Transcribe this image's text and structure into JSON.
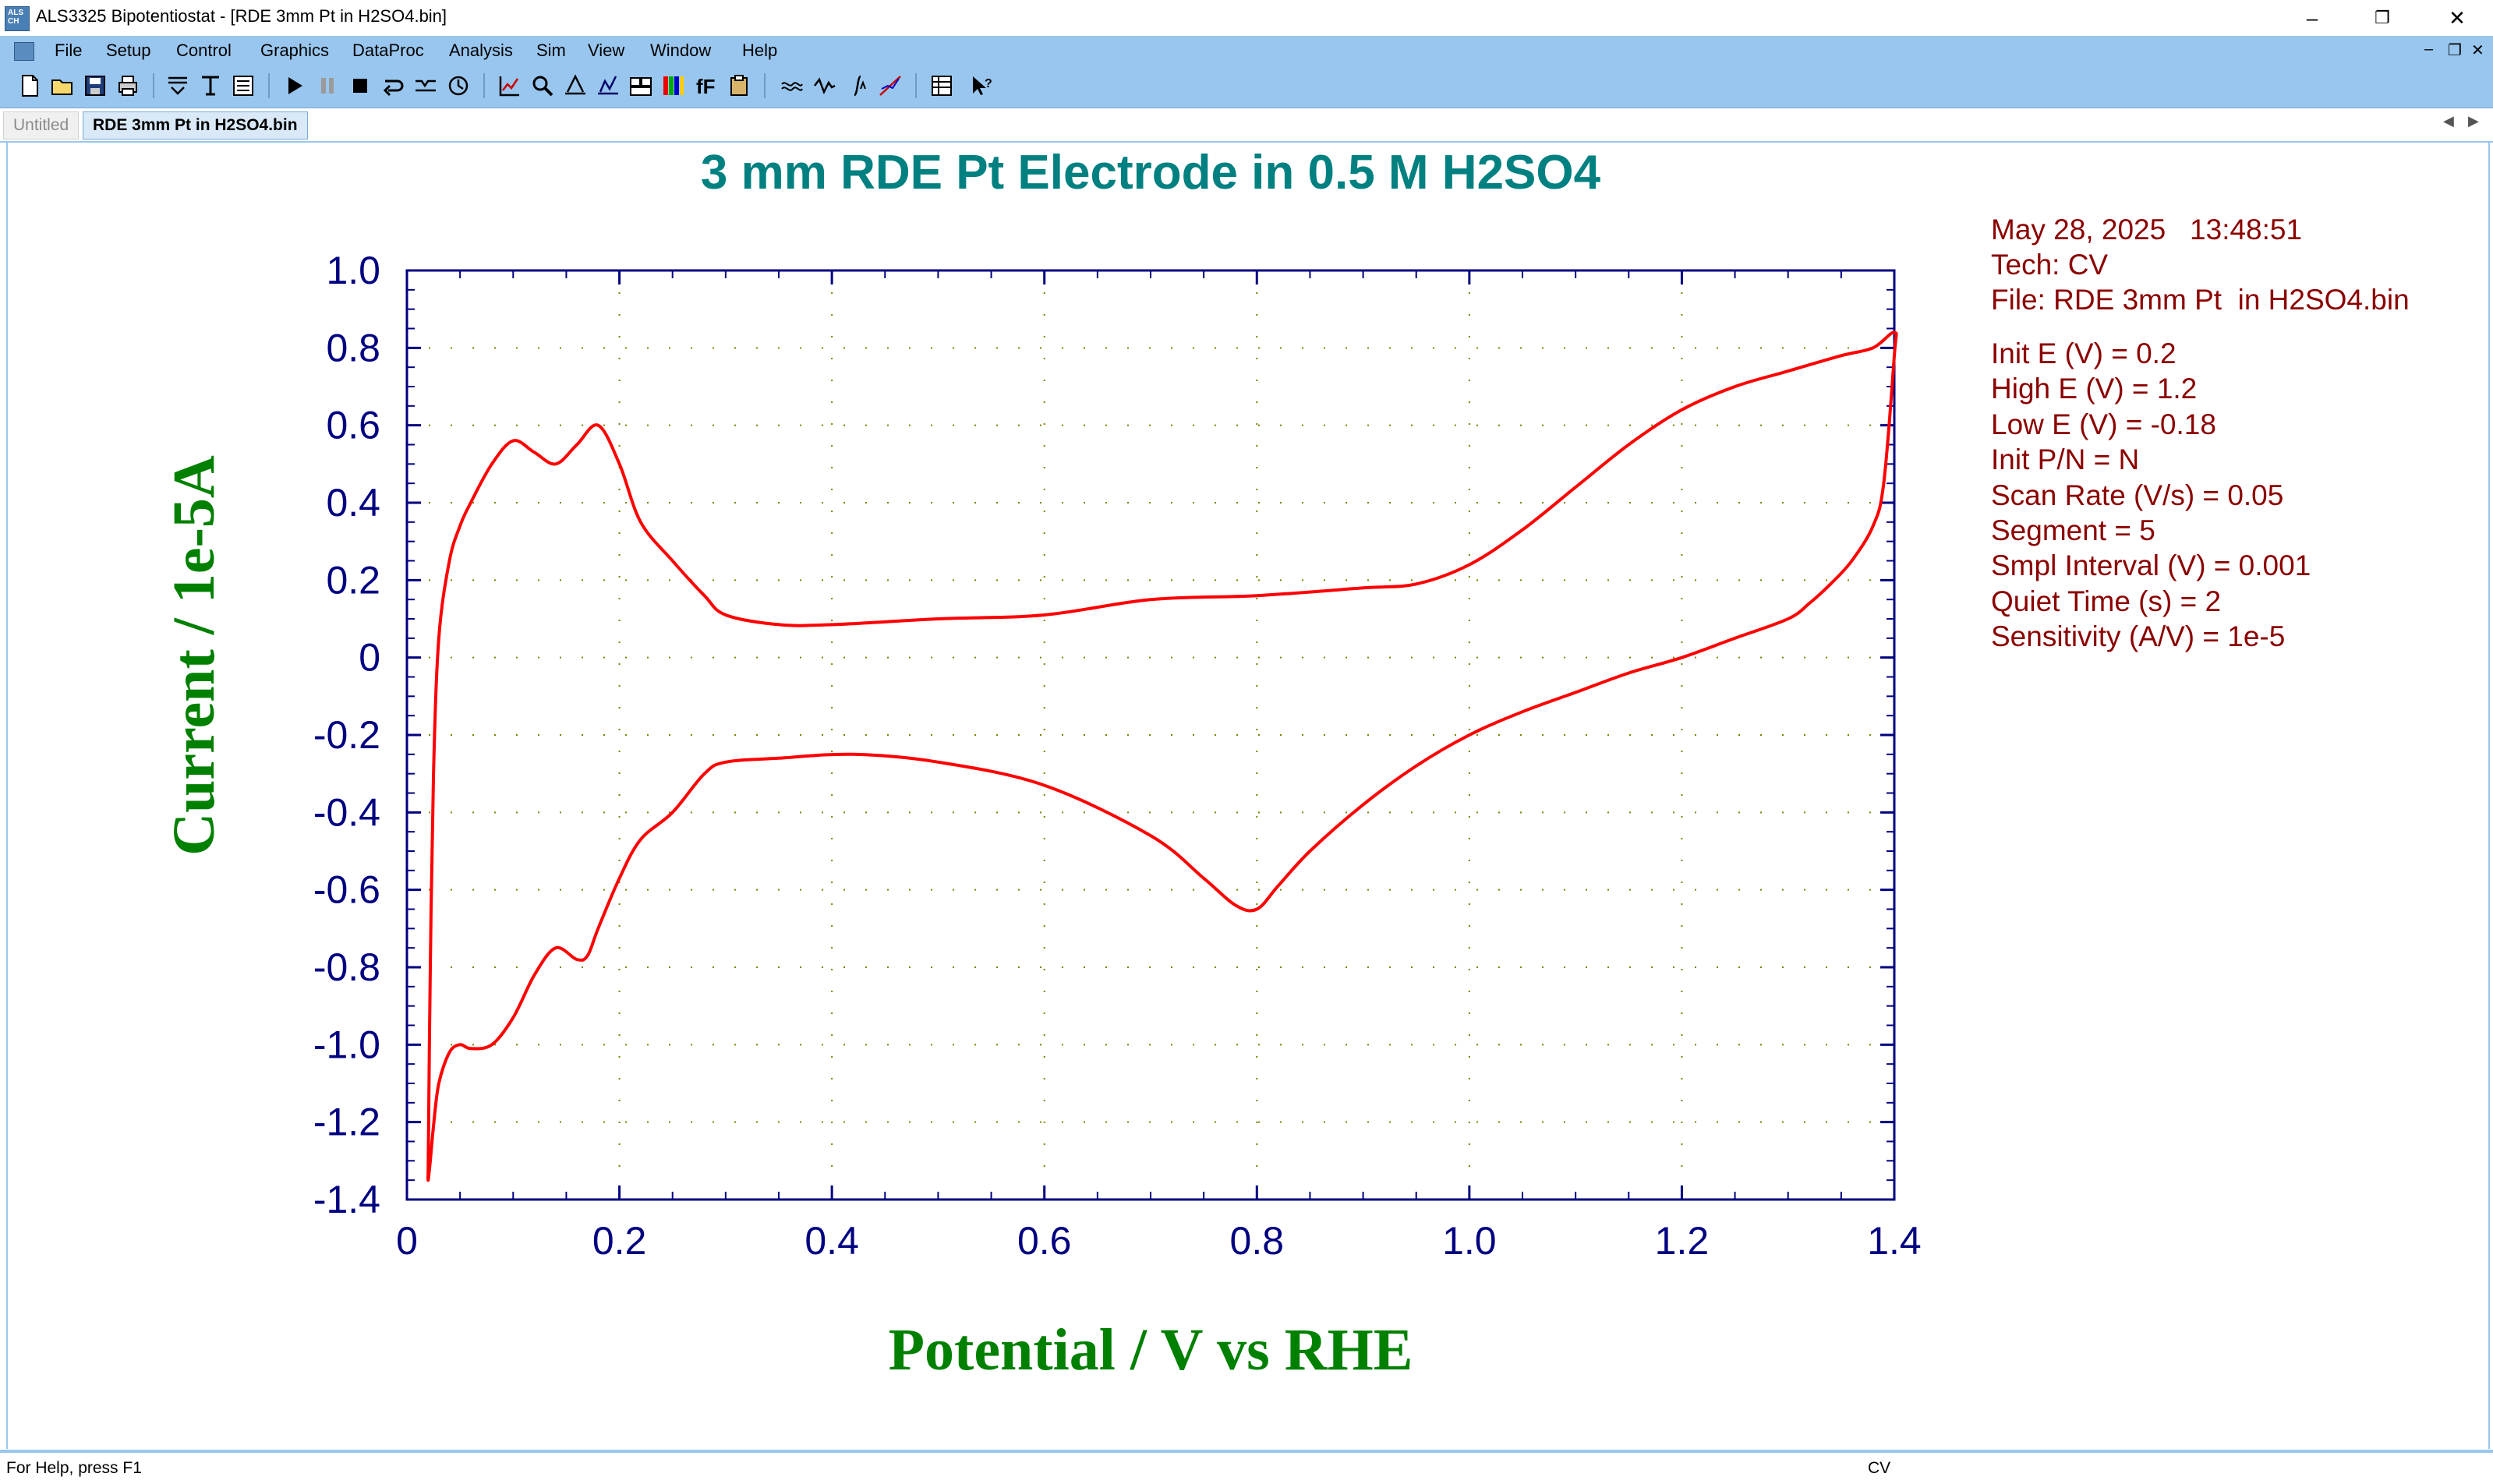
{
  "window": {
    "title": "ALS3325 Bipotentiostat - [RDE 3mm Pt  in H2SO4.bin]",
    "icon": "als-app-icon"
  },
  "menu": [
    {
      "label": "File"
    },
    {
      "label": "Setup"
    },
    {
      "label": "Control"
    },
    {
      "label": "Graphics"
    },
    {
      "label": "DataProc"
    },
    {
      "label": "Analysis"
    },
    {
      "label": "Sim"
    },
    {
      "label": "View"
    },
    {
      "label": "Window"
    },
    {
      "label": "Help"
    }
  ],
  "tabs": [
    {
      "label": "Untitled",
      "active": false
    },
    {
      "label": "RDE 3mm Pt  in H2SO4.bin",
      "active": true
    }
  ],
  "chart_data": {
    "type": "line",
    "title": "3 mm RDE Pt Electrode in 0.5 M H2SO4",
    "xlabel": "Potential / V vs RHE",
    "ylabel": "Current / 1e-5A",
    "xlim": [
      0,
      1.4
    ],
    "ylim": [
      -1.4,
      1.0
    ],
    "x_ticks": [
      "0",
      "0.2",
      "0.4",
      "0.6",
      "0.8",
      "1.0",
      "1.2",
      "1.4"
    ],
    "y_ticks": [
      "1.0",
      "0.8",
      "0.6",
      "0.4",
      "0.2",
      "0",
      "-0.2",
      "-0.4",
      "-0.6",
      "-0.8",
      "-1.0",
      "-1.2",
      "-1.4"
    ],
    "grid": "dotted",
    "line_color": "#ff0000",
    "series": [
      {
        "x": [
          0.02,
          0.022,
          0.025,
          0.03,
          0.04,
          0.05,
          0.06,
          0.08,
          0.1,
          0.12,
          0.14,
          0.16,
          0.18,
          0.2,
          0.22,
          0.25,
          0.28,
          0.3,
          0.35,
          0.4,
          0.5,
          0.6,
          0.7,
          0.8,
          0.9,
          0.95,
          1.0,
          1.05,
          1.1,
          1.15,
          1.2,
          1.25,
          1.3,
          1.35,
          1.38,
          1.4,
          1.4,
          1.39,
          1.38,
          1.36,
          1.34,
          1.32,
          1.3,
          1.25,
          1.2,
          1.15,
          1.1,
          1.05,
          1.0,
          0.95,
          0.9,
          0.85,
          0.82,
          0.8,
          0.78,
          0.75,
          0.7,
          0.6,
          0.5,
          0.42,
          0.35,
          0.3,
          0.28,
          0.25,
          0.22,
          0.2,
          0.18,
          0.17,
          0.16,
          0.14,
          0.12,
          0.1,
          0.08,
          0.06,
          0.05,
          0.04,
          0.03,
          0.025,
          0.022,
          0.02,
          0.02
        ],
        "y": [
          -1.32,
          -0.8,
          -0.3,
          0.05,
          0.25,
          0.34,
          0.4,
          0.5,
          0.56,
          0.53,
          0.5,
          0.55,
          0.6,
          0.5,
          0.35,
          0.25,
          0.16,
          0.11,
          0.085,
          0.085,
          0.1,
          0.11,
          0.15,
          0.16,
          0.18,
          0.19,
          0.24,
          0.33,
          0.44,
          0.55,
          0.64,
          0.7,
          0.74,
          0.78,
          0.8,
          0.84,
          0.78,
          0.45,
          0.34,
          0.25,
          0.19,
          0.14,
          0.1,
          0.05,
          0.0,
          -0.04,
          -0.09,
          -0.14,
          -0.2,
          -0.28,
          -0.38,
          -0.5,
          -0.59,
          -0.65,
          -0.64,
          -0.57,
          -0.46,
          -0.33,
          -0.27,
          -0.25,
          -0.26,
          -0.27,
          -0.3,
          -0.4,
          -0.47,
          -0.57,
          -0.7,
          -0.77,
          -0.78,
          -0.75,
          -0.82,
          -0.93,
          -1.0,
          -1.01,
          -1.0,
          -1.02,
          -1.1,
          -1.21,
          -1.3,
          -1.35,
          -1.32
        ]
      }
    ]
  },
  "info": {
    "date_time": "May 28, 2025   13:48:51",
    "tech": "Tech: CV",
    "file": "File: RDE 3mm Pt  in H2SO4.bin",
    "params": [
      "Init E (V) = 0.2",
      "High E (V) = 1.2",
      "Low E (V) = -0.18",
      "Init P/N = N",
      "Scan Rate (V/s) = 0.05",
      "Segment = 5",
      "Smpl Interval (V) = 0.001",
      "Quiet Time (s) = 2",
      "Sensitivity (A/V) = 1e-5"
    ]
  },
  "status": {
    "help_text": "For Help, press F1",
    "mode": "CV"
  },
  "colors": {
    "menu_bg": "#99c6ee",
    "title_color": "#008080",
    "axis_label_color": "#008000",
    "tick_color": "#000080",
    "info_color": "#8b0000",
    "curve_color": "#ff0000"
  }
}
